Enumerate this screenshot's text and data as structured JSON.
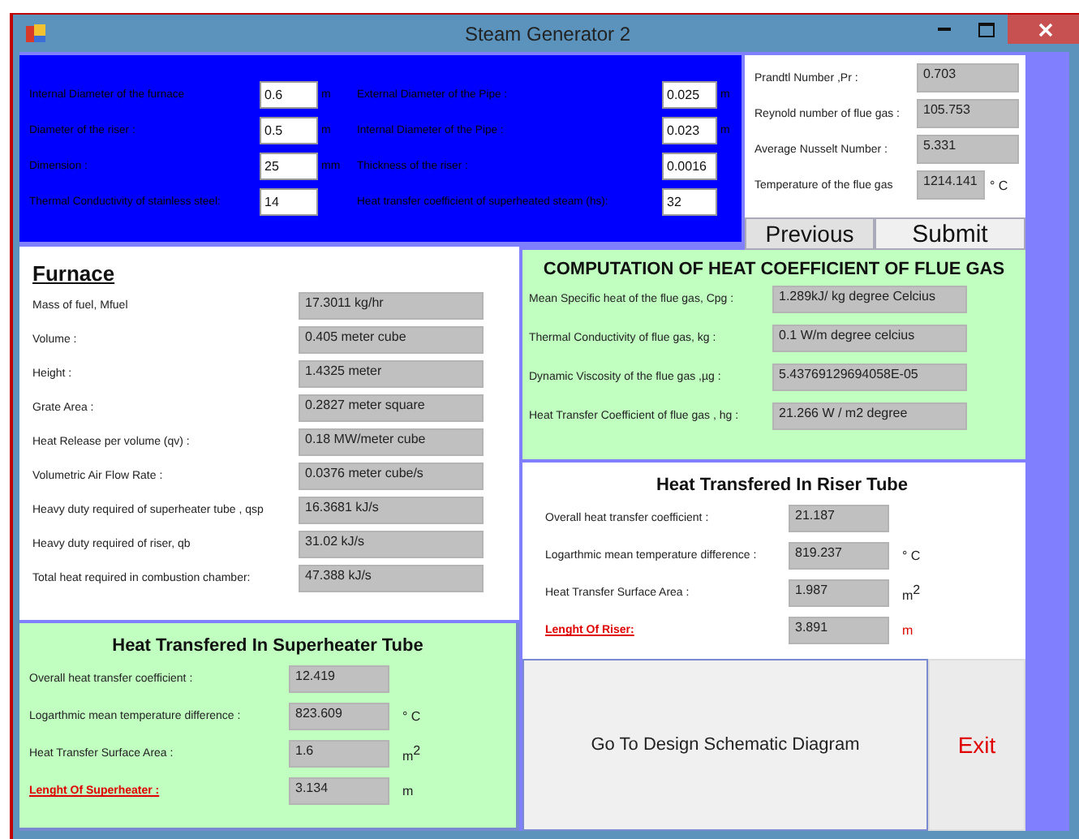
{
  "window": {
    "title": "Steam Generator 2"
  },
  "inputs": {
    "left": [
      {
        "label": "Internal Diameter of  the furnace",
        "value": "0.6",
        "unit": "m"
      },
      {
        "label": "Diameter of the riser :",
        "value": "0.5",
        "unit": "m"
      },
      {
        "label": "Dimension :",
        "value": "25",
        "unit": "mm"
      },
      {
        "label": "Thermal Conductivity of stainless steel:",
        "value": "14"
      }
    ],
    "right": [
      {
        "label": "External Diameter of the Pipe :",
        "value": "0.025",
        "unit": "m"
      },
      {
        "label": "Internal Diameter of the Pipe :",
        "value": "0.023",
        "unit": "m"
      },
      {
        "label": "Thickness of the riser :",
        "value": "0.0016"
      },
      {
        "label": "Heat transfer coefficient of superheated steam (hs):",
        "value": "32"
      }
    ]
  },
  "results": [
    {
      "label": "Prandtl Number ,Pr :",
      "value": "0.703"
    },
    {
      "label": "Reynold number of flue gas :",
      "value": "105.753"
    },
    {
      "label": "Average Nusselt Number :",
      "value": "5.331"
    },
    {
      "label": "Temperature of the flue gas",
      "value": "1214.141",
      "unit": "° C"
    }
  ],
  "nav_buttons": [
    {
      "label": "Previous",
      "kind": "previous"
    },
    {
      "label": "Submit",
      "kind": "submit"
    }
  ],
  "furnace": {
    "title": "Furnace",
    "rows": [
      {
        "label": "Mass of fuel, Mfuel",
        "value": "17.3011 kg/hr"
      },
      {
        "label": "Volume :",
        "value": "0.405 meter cube"
      },
      {
        "label": "Height :",
        "value": "1.4325 meter"
      },
      {
        "label": "Grate Area :",
        "value": "0.2827 meter square"
      },
      {
        "label": "Heat Release per volume (qv) :",
        "value": "0.18 MW/meter cube"
      },
      {
        "label": "Volumetric Air Flow Rate :",
        "value": "0.0376 meter cube/s"
      },
      {
        "label": "Heavy duty required of superheater tube , qsp",
        "value": "16.3681 kJ/s"
      },
      {
        "label": "Heavy duty required of riser, qb",
        "value": "31.02 kJ/s"
      },
      {
        "label": "Total heat required in combustion chamber:",
        "value": "47.388 kJ/s"
      }
    ]
  },
  "flue_gas": {
    "title": "COMPUTATION OF HEAT COEFFICIENT OF FLUE GAS",
    "rows": [
      {
        "label": "Mean Specific heat of the flue gas, Cpg :",
        "value": "1.289kJ/ kg degree Celcius"
      },
      {
        "label": "Thermal Conductivity of flue gas, kg :",
        "value": "0.1 W/m degree celcius"
      },
      {
        "label": "Dynamic Viscosity of the flue gas ,µg :",
        "value": "5.43769129694058E-05"
      },
      {
        "label": "Heat Transfer Coefficient of flue gas , hg :",
        "value": "21.266 W / m2 degree"
      }
    ]
  },
  "riser": {
    "title": "Heat Transfered In Riser Tube",
    "rows": [
      {
        "label": "Overall heat transfer coefficient :",
        "value": "21.187",
        "kind": "plain"
      },
      {
        "label": "Logarthmic mean temperature difference :",
        "value": "819.237",
        "unit": "° C",
        "kind": "plain",
        "unit_alert": false
      },
      {
        "label": "Heat Transfer Surface Area :",
        "value": "1.987",
        "unit": "m$^{2}$",
        "kind": "plain",
        "unit_alert": false
      },
      {
        "label": "Lenght Of Riser:",
        "value": "3.891",
        "unit": "m",
        "kind": "key",
        "unit_alert": true
      }
    ]
  },
  "superheater": {
    "title": "Heat Transfered In Superheater Tube",
    "rows": [
      {
        "label": "Overall heat transfer coefficient :",
        "value": "12.419",
        "kind": "plain"
      },
      {
        "label": "Logarthmic mean temperature difference :",
        "value": "823.609",
        "unit": "° C",
        "kind": "plain",
        "unit_alert": false
      },
      {
        "label": "Heat Transfer Surface Area :",
        "value": "1.6",
        "unit": "m$^{2}$",
        "kind": "plain",
        "unit_alert": false
      },
      {
        "label": "Lenght Of Superheater :",
        "value": "3.134",
        "unit": "m",
        "kind": "key",
        "unit_alert": false
      }
    ]
  },
  "actions": [
    {
      "label": "Go To Design Schematic Diagram",
      "kind": "design"
    },
    {
      "label": "Exit",
      "kind": "exit"
    }
  ]
}
